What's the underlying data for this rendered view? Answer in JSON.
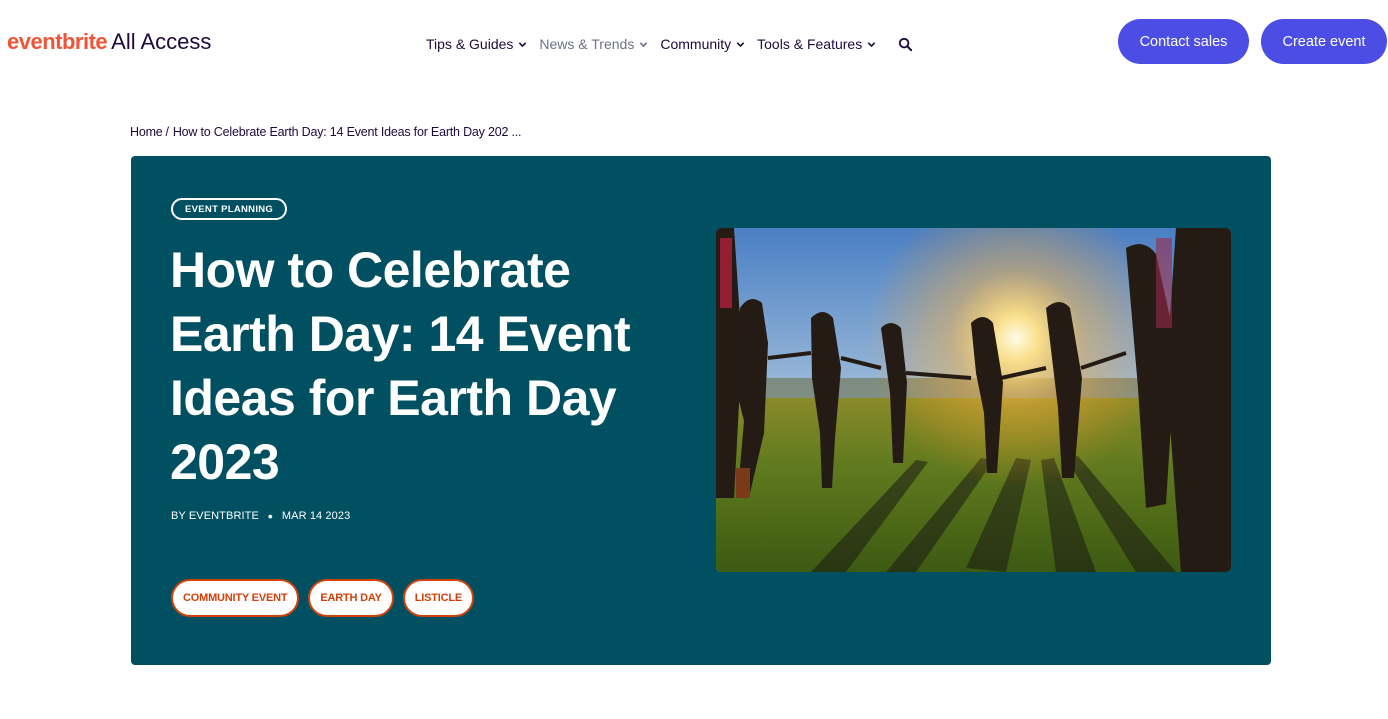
{
  "header": {
    "logo": {
      "brand": "eventbrite",
      "product": "All Access"
    },
    "nav": [
      {
        "label": "Tips & Guides"
      },
      {
        "label": "News & Trends"
      },
      {
        "label": "Community"
      },
      {
        "label": "Tools & Features"
      }
    ],
    "buttons": {
      "contact": "Contact sales",
      "create": "Create event"
    }
  },
  "breadcrumb": {
    "home": "Home",
    "separator": "/",
    "current": "How to Celebrate Earth Day: 14 Event Ideas for Earth Day 202 ..."
  },
  "article": {
    "category": "EVENT PLANNING",
    "title": "How to Celebrate Earth Day: 14 Event Ideas for Earth Day 2023",
    "author": "BY EVENTBRITE",
    "date": "MAR 14 2023",
    "tags": [
      "COMMUNITY EVENT",
      "EARTH DAY",
      "LISTICLE"
    ]
  },
  "colors": {
    "brand_orange": "#f05537",
    "primary_button": "#4b4de4",
    "hero_background": "#005061",
    "tag_accent": "#d1410c",
    "text_dark": "#1e0a3c"
  },
  "icons": {
    "nav_dropdown": "chevron-down-icon",
    "search": "search-icon"
  }
}
